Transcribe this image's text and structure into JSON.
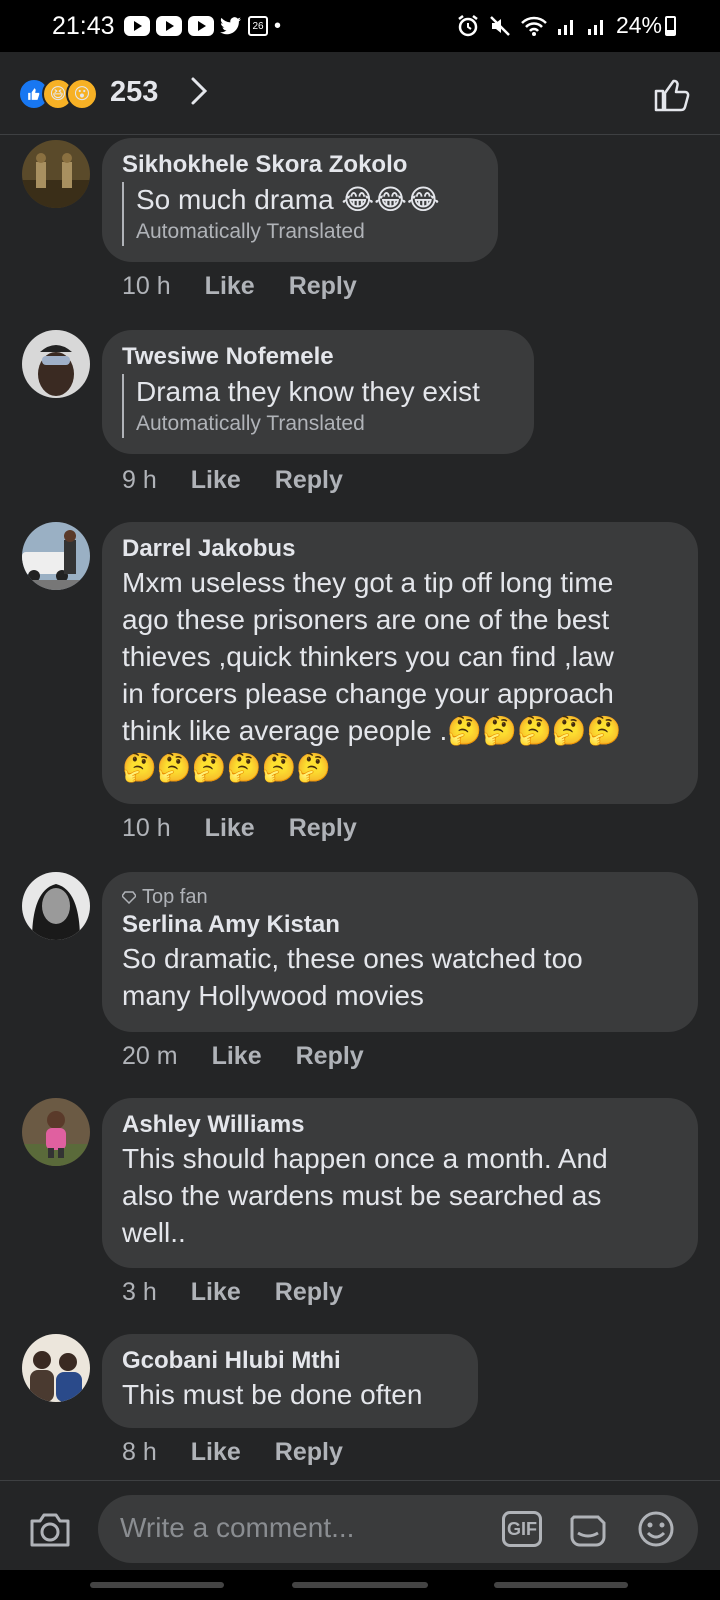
{
  "status_bar": {
    "time": "21:43",
    "battery": "24%",
    "calendar_day": "26"
  },
  "header": {
    "reaction_count": "253"
  },
  "comments": [
    {
      "name": "Sikhokhele Skora Zokolo",
      "text": "So much drama 😂😂😂",
      "translated_label": "Automatically Translated",
      "time": "10 h",
      "like": "Like",
      "reply": "Reply"
    },
    {
      "name": "Twesiwe Nofemele",
      "text": "Drama they know they exist",
      "translated_label": "Automatically Translated",
      "time": "9 h",
      "like": "Like",
      "reply": "Reply"
    },
    {
      "name": "Darrel Jakobus",
      "text_lines": [
        "Mxm useless they got a tip off long time",
        "ago these prisoners are one of the best",
        "thieves ,quick thinkers you can find ,law",
        "in forcers please change your approach",
        "think like average people .🤔🤔🤔🤔🤔",
        "🤔🤔🤔🤔🤔🤔"
      ],
      "time": "10 h",
      "like": "Like",
      "reply": "Reply"
    },
    {
      "badge": "Top fan",
      "name": "Serlina Amy Kistan",
      "text_lines": [
        "So dramatic, these ones watched too",
        "many Hollywood movies"
      ],
      "time": "20 m",
      "like": "Like",
      "reply": "Reply"
    },
    {
      "name": "Ashley Williams",
      "text_lines": [
        "This should happen once a month. And",
        "also the wardens must be searched as",
        "well.."
      ],
      "time": "3 h",
      "like": "Like",
      "reply": "Reply"
    },
    {
      "name": "Gcobani Hlubi Mthi",
      "text": "This must be done often",
      "time": "8 h",
      "like": "Like",
      "reply": "Reply"
    }
  ],
  "composer": {
    "placeholder": "Write a comment...",
    "gif_label": "GIF"
  },
  "colors": {
    "background": "#242526",
    "bubble": "#3a3b3c",
    "text": "#e4e6eb",
    "secondary": "#b0b3b8",
    "like_blue": "#1877f2"
  }
}
